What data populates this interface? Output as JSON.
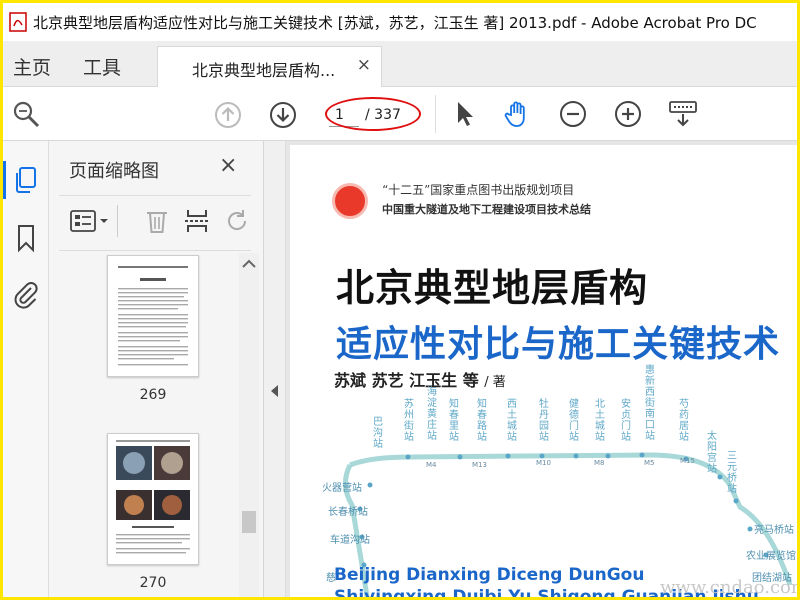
{
  "window": {
    "title": "北京典型地层盾构适应性对比与施工关键技术 [苏斌，苏艺，江玉生 著] 2013.pdf - Adobe Acrobat Pro DC"
  },
  "tabs": {
    "home": "主页",
    "tools": "工具",
    "document": "北京典型地层盾构...",
    "close": "×"
  },
  "toolbar": {
    "page_current": "1",
    "page_total": "/ 337"
  },
  "thumbnail_panel": {
    "title": "页面缩略图",
    "close": "×",
    "pages": [
      "269",
      "270"
    ]
  },
  "cover": {
    "series_line_1": "“十二五”国家重点图书出版规划项目",
    "series_line_2": "中国重大隧道及地下工程建设项目技术总结",
    "title_line_1": "北京典型地层盾构",
    "title_line_2": "适应性对比与施工关键技术",
    "authors": "苏斌   苏艺   江玉生  等",
    "authors_suffix": "/ 著",
    "stations_vertical": [
      "巴沟站",
      "苏州街站",
      "海淀黄庄站",
      "知春里站",
      "知春路站",
      "西土城站",
      "牡丹园站",
      "健德门站",
      "北土城站",
      "安贞门站",
      "惠新西街南口站",
      "芍药居站",
      "太阳宫站",
      "三元桥站"
    ],
    "stations_horizontal": [
      "火器营站",
      "长春桥站",
      "车道沟站",
      "慈",
      "亮马桥站",
      "农业展览馆",
      "团结湖站"
    ],
    "line_codes": [
      "M4",
      "M13",
      "M10",
      "M8",
      "M5",
      "M15"
    ],
    "pinyin_1": "Beijing Dianxing Diceng DunGou",
    "pinyin_2": "Shiyingxing Duibi Yu Shigong Guanjian Jishu",
    "watermark": "www.cndao.com"
  },
  "colors": {
    "frame_border": "#ffe600",
    "accent_blue": "#1473e6",
    "annotation_red": "#e01010",
    "title_blue": "#1b67c9"
  }
}
